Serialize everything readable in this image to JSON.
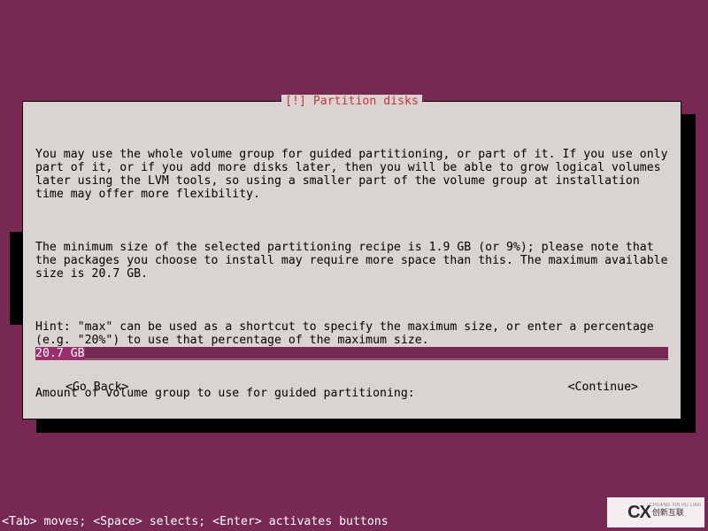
{
  "dialog": {
    "title": "[!] Partition disks",
    "paragraphs": {
      "p1": "You may use the whole volume group for guided partitioning, or part of it. If you use only part of it, or if you add more disks later, then you will be able to grow logical volumes later using the LVM tools, so using a smaller part of the volume group at installation time may offer more flexibility.",
      "p2": "The minimum size of the selected partitioning recipe is 1.9 GB (or 9%); please note that the packages you choose to install may require more space than this. The maximum available size is 20.7 GB.",
      "p3": "Hint: \"max\" can be used as a shortcut to specify the maximum size, or enter a percentage (e.g. \"20%\") to use that percentage of the maximum size.",
      "prompt": "Amount of volume group to use for guided partitioning:"
    },
    "input": {
      "value": "20.7 GB",
      "fill": "___________________________________________________________________________________"
    },
    "nav": {
      "back": "<Go Back>",
      "continue": "<Continue>"
    }
  },
  "helpbar": "<Tab> moves; <Space> selects; <Enter> activates buttons",
  "watermark": {
    "logo": "CX",
    "text": "创新互联",
    "sub": "CHUANG XIN HU LIAN"
  }
}
